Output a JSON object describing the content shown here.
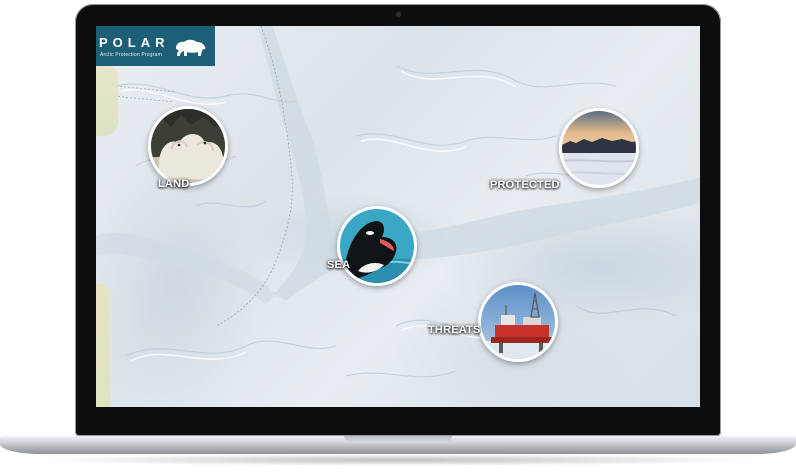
{
  "app": {
    "title": "POLAR",
    "subtitle": "Arctic Protection Program",
    "logo_icon": "polar-bear-icon"
  },
  "hotspots": [
    {
      "id": "land",
      "label": "LAND",
      "image": "polar-bears-photo"
    },
    {
      "id": "protected",
      "label": "PROTECTED",
      "image": "frozen-lake-sunset-photo"
    },
    {
      "id": "sea",
      "label": "SEA",
      "image": "orca-photo"
    },
    {
      "id": "threats",
      "label": "THREATS",
      "image": "oil-rig-photo"
    }
  ],
  "colors": {
    "brand": "#1e5f78",
    "map_ice": "#e3e9ee",
    "map_water": "#c7d3dd",
    "label_text": "#ffffff"
  }
}
